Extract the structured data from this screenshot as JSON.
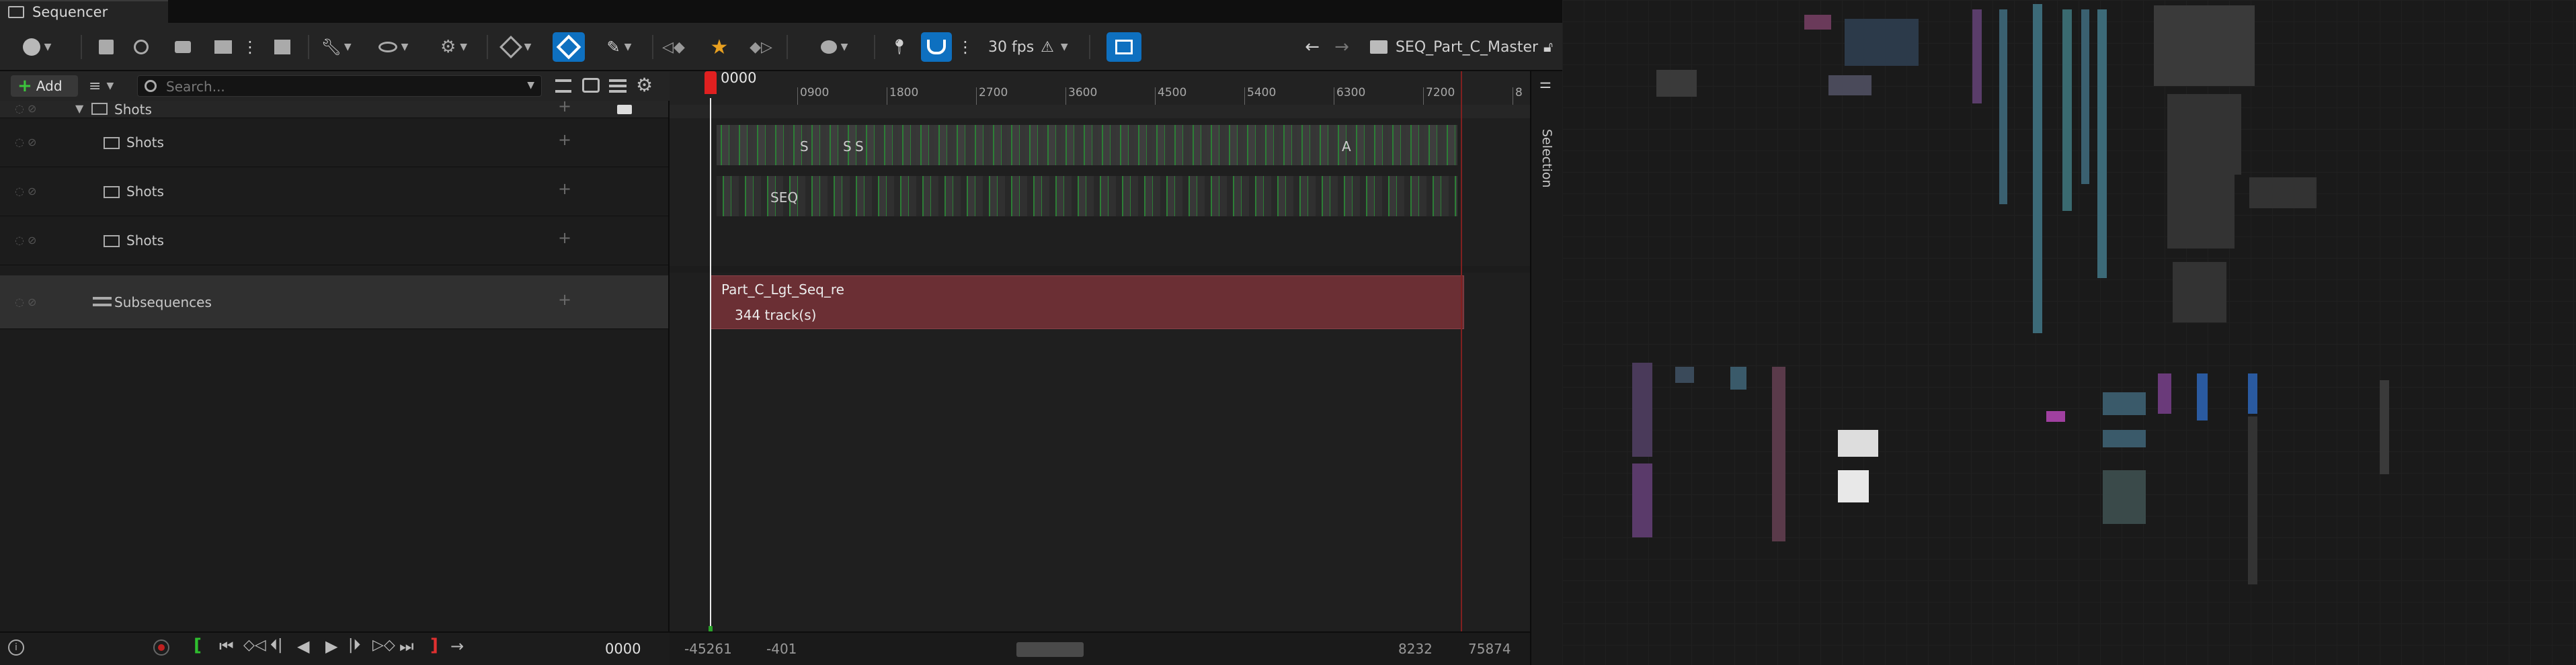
{
  "window": {
    "tab_title": "Sequencer"
  },
  "toolbar": {
    "framerate": "30 fps",
    "sequence_name": "SEQ_Part_C_Master"
  },
  "outliner": {
    "add_label": "Add",
    "search_placeholder": "Search...",
    "tracks": [
      {
        "label": "Shots"
      },
      {
        "label": "Shots"
      },
      {
        "label": "Shots"
      },
      {
        "label": "Shots"
      },
      {
        "label": "Subsequences"
      }
    ]
  },
  "timeline": {
    "current_frame": "0000",
    "ruler_ticks": [
      "0900",
      "1800",
      "2700",
      "3600",
      "4500",
      "5400",
      "6300",
      "7200",
      "8"
    ],
    "subsequence_section": {
      "name": "Part_C_Lgt_Seq_re",
      "tracks": "344 track(s)"
    },
    "shot_fragments": [
      "S",
      "S",
      "S",
      "A",
      "SEQ"
    ],
    "view_start": "-45261",
    "play_start": "-401",
    "play_end": "8232",
    "view_end": "75874"
  },
  "transport": {
    "frame": "0000"
  },
  "side_panel": {
    "label": "Selection"
  },
  "colors": {
    "accent_blue": "#0e70c0",
    "playhead": "#e02020",
    "subsequence": "#6b2f34",
    "shot_green": "#2f8f3a"
  }
}
